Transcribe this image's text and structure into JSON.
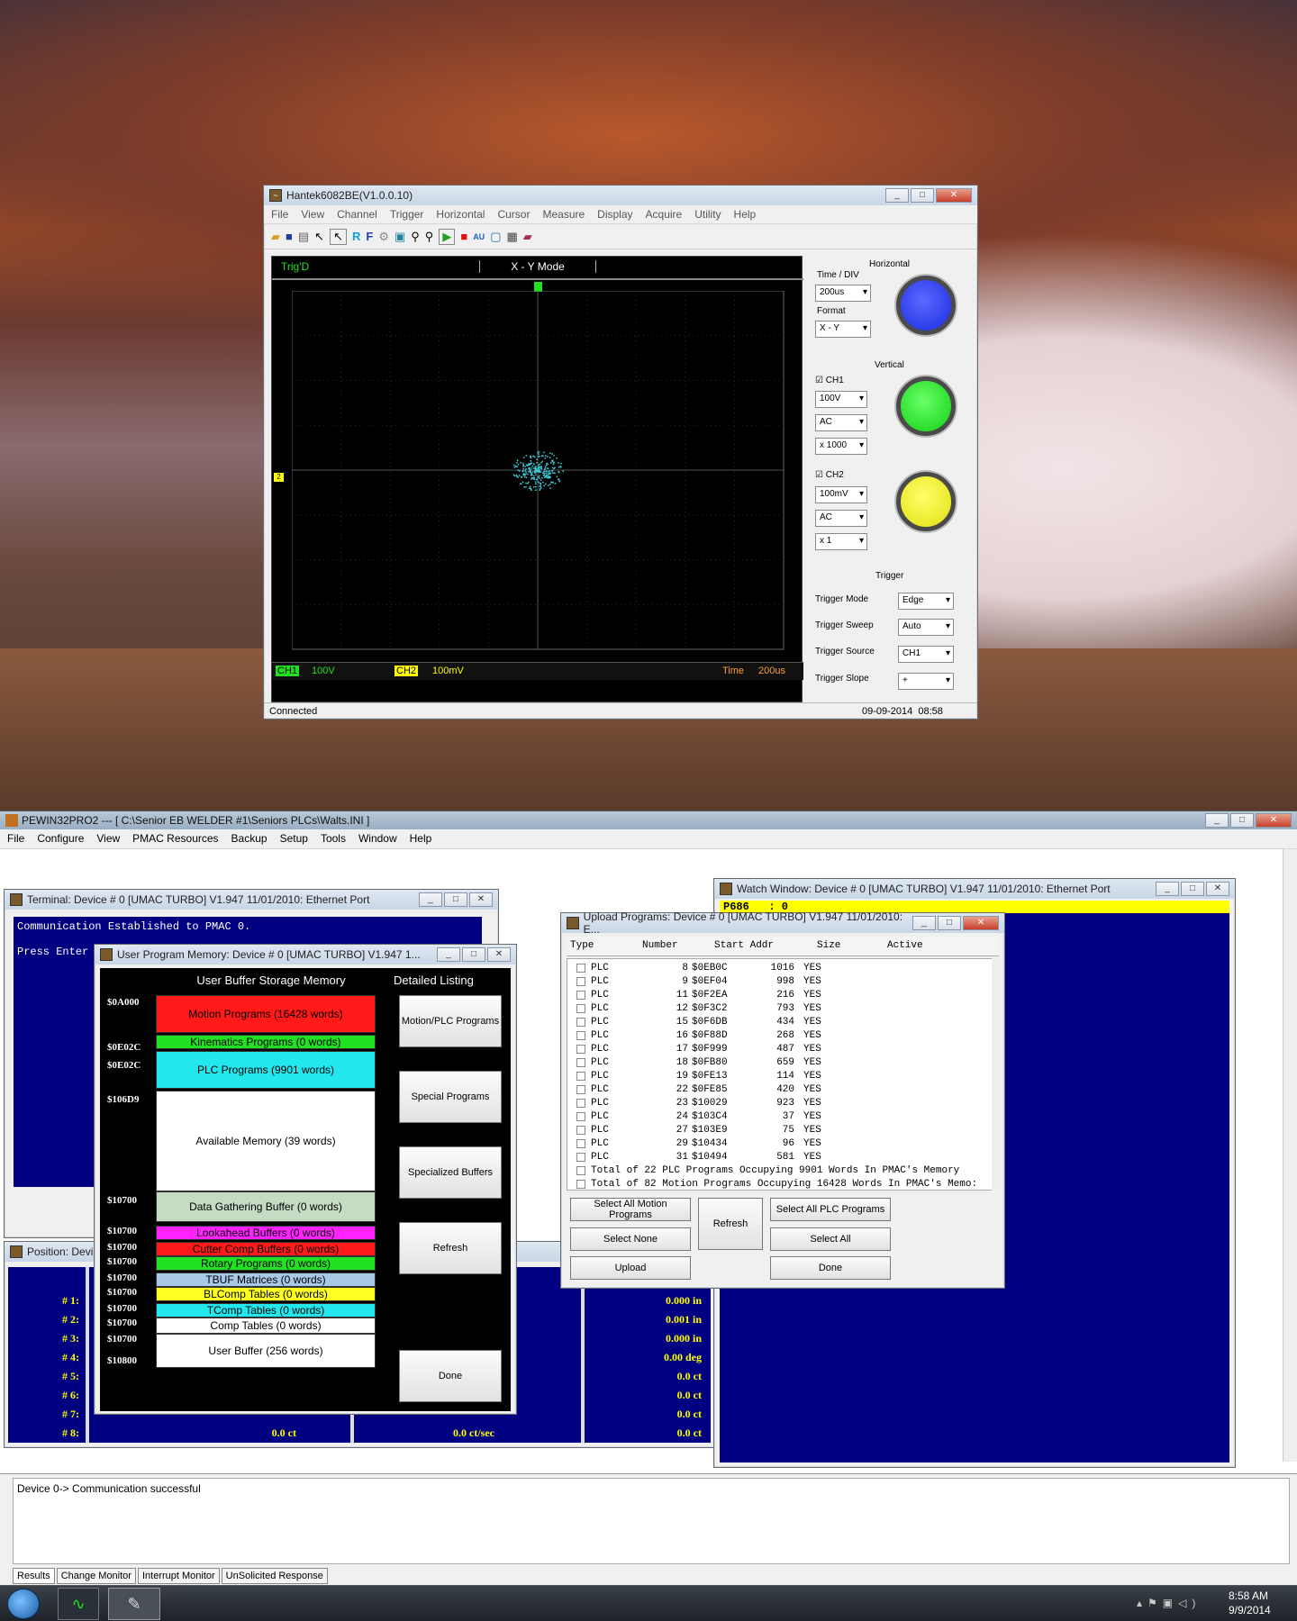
{
  "hantek": {
    "title": "Hantek6082BE(V1.0.0.10)",
    "menu": [
      "File",
      "View",
      "Channel",
      "Trigger",
      "Horizontal",
      "Cursor",
      "Measure",
      "Display",
      "Acquire",
      "Utility",
      "Help"
    ],
    "trig_status": "Trig'D",
    "mode": "X - Y Mode",
    "ch1_label": "CH1",
    "ch1_value": "100V",
    "ch2_label": "CH2",
    "ch2_value": "100mV",
    "time_label": "Time",
    "time_value": "200us",
    "status": "Connected",
    "datetime": "09-09-2014  08:58",
    "horizontal": {
      "title": "Horizontal",
      "time_div_label": "Time / DIV",
      "time_div": "200us",
      "format_label": "Format",
      "format": "X - Y"
    },
    "vertical": {
      "title": "Vertical",
      "ch1": "CH1",
      "ch1_volts": "100V",
      "ch1_coupling": "AC",
      "ch1_probe": "x 1000",
      "ch2": "CH2",
      "ch2_volts": "100mV",
      "ch2_coupling": "AC",
      "ch2_probe": "x 1"
    },
    "trigger": {
      "title": "Trigger",
      "mode_label": "Trigger Mode",
      "mode": "Edge",
      "sweep_label": "Trigger Sweep",
      "sweep": "Auto",
      "source_label": "Trigger Source",
      "source": "CH1",
      "slope_label": "Trigger Slope",
      "slope": "+"
    },
    "colors": {
      "ch1": "#20ff20",
      "ch2": "#ffff00",
      "trace": "#40d0e0"
    }
  },
  "pewin": {
    "title": "PEWIN32PRO2 --- [ C:\\Senior EB WELDER #1\\Seniors PLCs\\Walts.INI ]",
    "menu": [
      "File",
      "Configure",
      "View",
      "PMAC Resources",
      "Backup",
      "Setup",
      "Tools",
      "Window",
      "Help"
    ],
    "output": "Device 0-> Communication successful",
    "tabs": [
      "Results",
      "Change Monitor",
      "Interrupt Monitor",
      "UnSolicited Response"
    ]
  },
  "terminal": {
    "title": "Terminal: Device # 0 [UMAC TURBO] V1.947  11/01/2010: Ethernet Port",
    "line1": "Communication Established to PMAC 0.",
    "line2": "Press Enter"
  },
  "watch": {
    "title": "Watch Window: Device # 0 [UMAC TURBO] V1.947  11/01/2010: Ethernet Port",
    "row": "P686   : 0"
  },
  "position": {
    "title": "Position: Devi",
    "labels": [
      "# 1:",
      "# 2:",
      "# 3:",
      "# 4:",
      "# 5:",
      "# 6:",
      "# 7:",
      "# 8:"
    ],
    "values": [
      "0.000 in",
      "0.001 in",
      "0.000 in",
      "0.00 deg",
      "0.0 ct",
      "0.0 ct",
      "0.0 ct",
      "0.0 ct"
    ],
    "row8_col1": "0.0 ct",
    "row8_col2": "0.0 ct/sec"
  },
  "memory": {
    "title": "User Program Memory: Device # 0 [UMAC TURBO] V1.947  1...",
    "header": "User Buffer Storage Memory",
    "detail_header": "Detailed Listing",
    "addresses": [
      "$0A000",
      "$0E02C",
      "$0E02C",
      "$106D9",
      "$10700",
      "$10700",
      "$10700",
      "$10700",
      "$10700",
      "$10700",
      "$10700",
      "$10700",
      "$10700",
      "$10800"
    ],
    "buffers": [
      {
        "label": "Motion Programs (16428 words)",
        "color": "#ff1a1a"
      },
      {
        "label": "Kinematics Programs (0 words)",
        "color": "#22e022"
      },
      {
        "label": "PLC Programs (9901 words)",
        "color": "#22e8ee"
      },
      {
        "label": "Available Memory (39 words)",
        "color": "#ffffff"
      },
      {
        "label": "Data Gathering Buffer (0 words)",
        "color": "#c4dcc4"
      },
      {
        "label": "Lookahead Buffers (0 words)",
        "color": "#ff22ff"
      },
      {
        "label": "Cutter Comp Buffers (0 words)",
        "color": "#ff1a1a"
      },
      {
        "label": "Rotary Programs (0 words)",
        "color": "#22e022"
      },
      {
        "label": "TBUF Matrices (0 words)",
        "color": "#a8c8e8"
      },
      {
        "label": "BLComp Tables (0 words)",
        "color": "#ffff22"
      },
      {
        "label": "TComp Tables (0 words)",
        "color": "#22e8ee"
      },
      {
        "label": "Comp Tables (0 words)",
        "color": "#ffffff"
      },
      {
        "label": "User Buffer (256 words)",
        "color": "#ffffff"
      }
    ],
    "buttons": [
      "Motion/PLC Programs",
      "Special Programs",
      "Specialized Buffers",
      "Refresh",
      "Done"
    ]
  },
  "upload": {
    "title": "Upload Programs: Device # 0 [UMAC TURBO] V1.947  11/01/2010: E...",
    "columns": [
      "Type",
      "Number",
      "Start Addr",
      "Size",
      "Active"
    ],
    "rows": [
      [
        "PLC",
        "8",
        "$0EB0C",
        "1016",
        "YES"
      ],
      [
        "PLC",
        "9",
        "$0EF04",
        "998",
        "YES"
      ],
      [
        "PLC",
        "11",
        "$0F2EA",
        "216",
        "YES"
      ],
      [
        "PLC",
        "12",
        "$0F3C2",
        "793",
        "YES"
      ],
      [
        "PLC",
        "15",
        "$0F6DB",
        "434",
        "YES"
      ],
      [
        "PLC",
        "16",
        "$0F88D",
        "268",
        "YES"
      ],
      [
        "PLC",
        "17",
        "$0F999",
        "487",
        "YES"
      ],
      [
        "PLC",
        "18",
        "$0FB80",
        "659",
        "YES"
      ],
      [
        "PLC",
        "19",
        "$0FE13",
        "114",
        "YES"
      ],
      [
        "PLC",
        "22",
        "$0FE85",
        "420",
        "YES"
      ],
      [
        "PLC",
        "23",
        "$10029",
        "923",
        "YES"
      ],
      [
        "PLC",
        "24",
        "$103C4",
        "37",
        "YES"
      ],
      [
        "PLC",
        "27",
        "$103E9",
        "75",
        "YES"
      ],
      [
        "PLC",
        "29",
        "$10434",
        "96",
        "YES"
      ],
      [
        "PLC",
        "31",
        "$10494",
        "581",
        "YES"
      ]
    ],
    "total1": "Total of 22 PLC Programs Occupying 9901 Words In PMAC's Memory",
    "total2": "Total of 82 Motion Programs Occupying 16428 Words In PMAC's Memo:",
    "buttons": {
      "select_all_motion": "Select All Motion Programs",
      "select_none": "Select None",
      "upload": "Upload",
      "refresh": "Refresh",
      "select_all_plc": "Select All PLC Programs",
      "select_all": "Select All",
      "done": "Done"
    }
  },
  "taskbar": {
    "time": "8:58 AM",
    "date": "9/9/2014"
  }
}
